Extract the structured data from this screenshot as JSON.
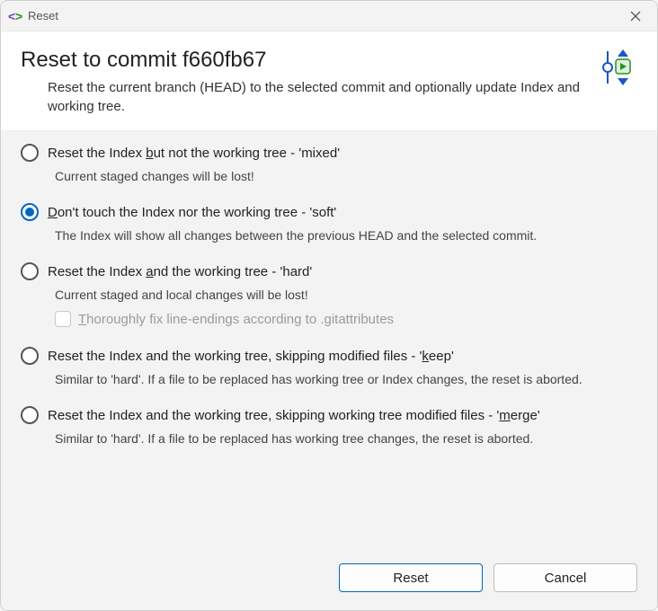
{
  "titlebar": {
    "title": "Reset"
  },
  "header": {
    "title": "Reset to commit f660fb67",
    "description": "Reset the current branch (HEAD) to the selected commit and optionally update Index and working tree."
  },
  "options": {
    "mixed": {
      "label_pre": "Reset the Index ",
      "label_u": "b",
      "label_post": "ut not the working tree - 'mixed'",
      "desc": "Current staged changes will be lost!"
    },
    "soft": {
      "label_u": "D",
      "label_post": "on't touch the Index nor the working tree - 'soft'",
      "desc": "The Index will show all changes between the previous HEAD and the selected commit."
    },
    "hard": {
      "label_pre": "Reset the Index ",
      "label_u": "a",
      "label_post": "nd the working tree - 'hard'",
      "desc": "Current staged and local changes will be lost!",
      "sub_u": "T",
      "sub_post": "horoughly fix line-endings according to .gitattributes"
    },
    "keep": {
      "label_pre": "Reset the Index and the working tree, skipping modified files - '",
      "label_u": "k",
      "label_post": "eep'",
      "desc": "Similar to 'hard'. If a file to be replaced has working tree or Index changes, the reset is aborted."
    },
    "merge": {
      "label_pre": "Reset the Index and the working tree, skipping working tree modified files - '",
      "label_u": "m",
      "label_post": "erge'",
      "desc": "Similar to 'hard'. If a file to be replaced has working tree changes, the reset is aborted."
    }
  },
  "footer": {
    "reset": "Reset",
    "cancel": "Cancel"
  },
  "selected": "soft"
}
